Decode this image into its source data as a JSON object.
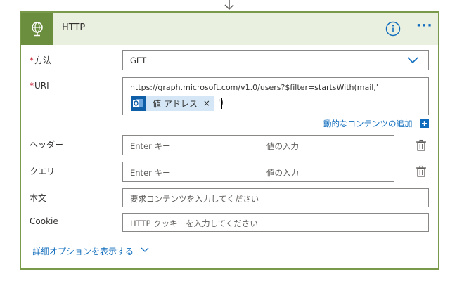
{
  "header": {
    "title": "HTTP"
  },
  "fields": {
    "method": {
      "label": "方法",
      "required_mark": "*",
      "value": "GET"
    },
    "uri": {
      "label": "URI",
      "required_mark": "*",
      "value_text": "https://graph.microsoft.com/v1.0/users?$filter=startsWith(mail,'",
      "token_label": "値 アドレス",
      "token_close": "×",
      "after_token": "')"
    },
    "dynamic_content_link": "動的なコンテンツの追加",
    "headers": {
      "label": "ヘッダー",
      "key_placeholder": "Enter キー",
      "value_placeholder": "値の入力"
    },
    "query": {
      "label": "クエリ",
      "key_placeholder": "Enter キー",
      "value_placeholder": "値の入力"
    },
    "body": {
      "label": "本文",
      "placeholder": "要求コンテンツを入力してください"
    },
    "cookie": {
      "label": "Cookie",
      "placeholder": "HTTP クッキーを入力してください"
    }
  },
  "advanced_options_link": "詳細オプションを表示する",
  "colors": {
    "accent": "#0f6cbd",
    "card_border": "#799a4a",
    "header_bg": "#eaf0df",
    "header_icon_bg": "#6b8e3e",
    "required": "#c50f1f",
    "token_bg": "#d5e7f7"
  },
  "icons": {
    "header": "globe-icon",
    "info": "info-icon",
    "more": "more-icon",
    "method_dropdown": "chevron-down-icon",
    "token": "outlook-icon",
    "delete_row": "trash-icon",
    "advanced": "chevron-down-icon"
  }
}
